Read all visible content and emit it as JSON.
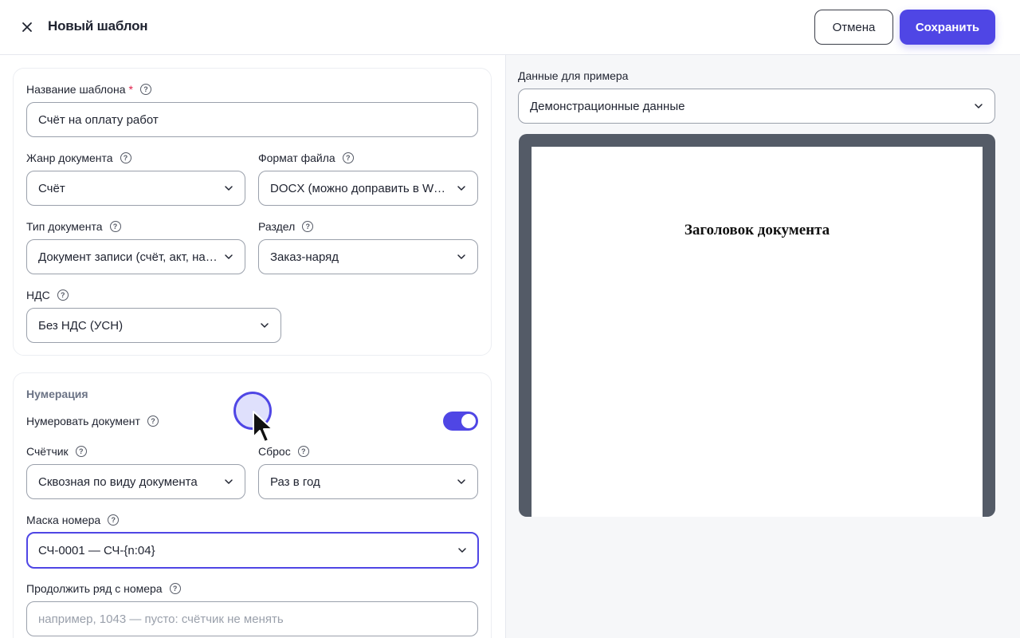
{
  "header": {
    "title": "Новый шаблон",
    "cancel_label": "Отмена",
    "save_label": "Сохранить"
  },
  "template": {
    "name_label": "Название шаблона",
    "required_mark": "*",
    "name_value": "Счёт на оплату работ",
    "genre_label": "Жанр документа",
    "genre_value": "Счёт",
    "format_label": "Формат файла",
    "format_value": "DOCX (можно доправить в Word)",
    "doc_type_label": "Тип документа",
    "doc_type_value": "Документ записи (счёт, акт, наряд)",
    "section_label": "Раздел",
    "section_value": "Заказ-наряд",
    "vat_label": "НДС",
    "vat_value": "Без НДС (УСН)"
  },
  "numbering": {
    "title": "Нумерация",
    "enable_label": "Нумеровать документ",
    "enabled": true,
    "counter_label": "Счётчик",
    "counter_value": "Сквозная по виду документа",
    "reset_label": "Сброс",
    "reset_value": "Раз в год",
    "mask_label": "Маска номера",
    "mask_value": "СЧ-0001 — СЧ-{n:04}",
    "continue_label": "Продолжить ряд с номера",
    "continue_placeholder": "например, 1043 — пусто: счётчик не менять"
  },
  "preview": {
    "data_label": "Данные для примера",
    "data_value": "Демонстрационные данные",
    "doc_heading": "Заголовок документа"
  },
  "colors": {
    "accent": "#4f46e5",
    "required": "#e11d48",
    "preview_frame": "#545b67"
  },
  "icons": {
    "close": "close-icon",
    "help": "help-circle-icon",
    "chevron": "chevron-down-icon"
  }
}
